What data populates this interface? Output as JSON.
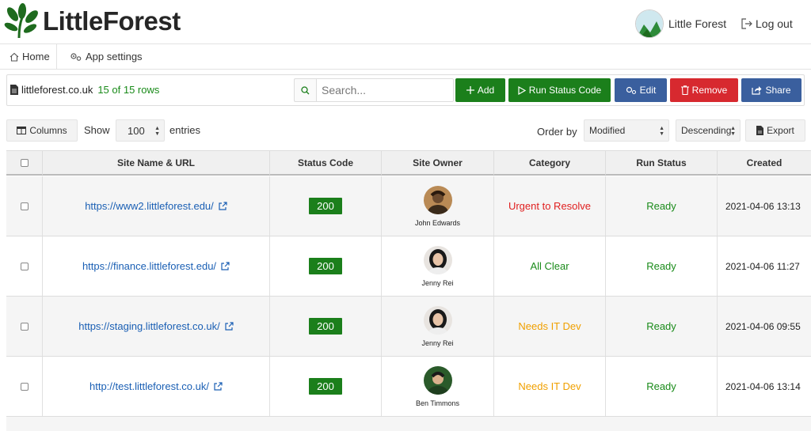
{
  "app": {
    "logo_text": "LittleForest"
  },
  "user": {
    "name": "Little Forest",
    "logout_label": "Log out"
  },
  "nav": {
    "home": "Home",
    "settings": "App settings"
  },
  "toolbar": {
    "site": "littleforest.co.uk",
    "rows": "15 of 15 rows",
    "search_placeholder": "Search...",
    "add": "Add",
    "run": "Run Status Code",
    "edit": "Edit",
    "remove": "Remove",
    "share": "Share"
  },
  "controls": {
    "columns": "Columns",
    "show": "Show",
    "entries_value": "100",
    "entries": "entries",
    "order_by": "Order by",
    "order_value": "Modified",
    "direction_value": "Descending",
    "export": "Export"
  },
  "table": {
    "headers": [
      "Site Name & URL",
      "Status Code",
      "Site Owner",
      "Category",
      "Run Status",
      "Created"
    ],
    "rows": [
      {
        "url": "https://www2.littleforest.edu/",
        "code": "200",
        "owner": "John Edwards",
        "category": "Urgent to Resolve",
        "category_color": "#e02020",
        "status": "Ready",
        "created": "2021-04-06 13:13"
      },
      {
        "url": "https://finance.littleforest.edu/",
        "code": "200",
        "owner": "Jenny Rei",
        "category": "All Clear",
        "category_color": "#1a8b1a",
        "status": "Ready",
        "created": "2021-04-06 11:27"
      },
      {
        "url": "https://staging.littleforest.co.uk/",
        "code": "200",
        "owner": "Jenny Rei",
        "category": "Needs IT Dev",
        "category_color": "#f0a000",
        "status": "Ready",
        "created": "2021-04-06 09:55"
      },
      {
        "url": "http://test.littleforest.co.uk/",
        "code": "200",
        "owner": "Ben Timmons",
        "category": "Needs IT Dev",
        "category_color": "#f0a000",
        "status": "Ready",
        "created": "2021-04-06 13:14"
      }
    ]
  },
  "colors": {
    "green": "#1b7f1b",
    "blue": "#3a5f9e",
    "red": "#d7292f",
    "link": "#1a5fb4"
  }
}
